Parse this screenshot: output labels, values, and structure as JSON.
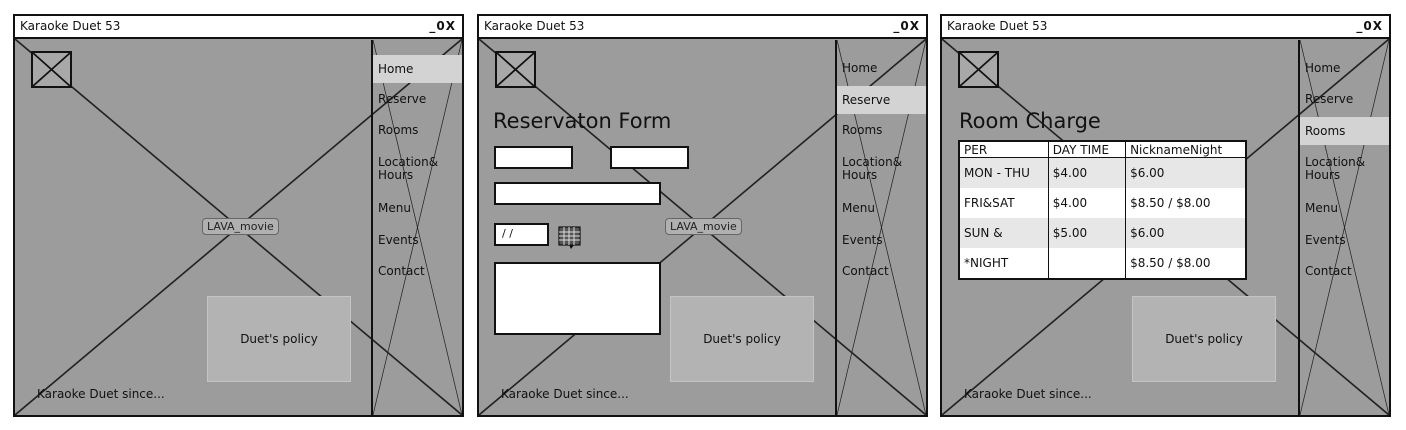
{
  "window": {
    "title": "Karaoke Duet 53",
    "controls": "_0X"
  },
  "nav": [
    "Home",
    "Reserve",
    "Rooms",
    "Location&",
    "Hours",
    "Menu",
    "Events",
    "Contact"
  ],
  "video_label": "LAVA_movie",
  "policy_label": "Duet's policy",
  "footer_text": "Karaoke Duet since...",
  "reservation": {
    "heading": "Reservaton Form",
    "date_value": "/ /"
  },
  "room_charge": {
    "heading": "Room Charge",
    "headers": [
      "PER",
      "DAY TIME",
      "NicknameNight"
    ],
    "rows": [
      [
        "MON - THU",
        "$4.00",
        "$6.00"
      ],
      [
        "FRI&SAT",
        "$4.00",
        "$8.50 / $8.00"
      ],
      [
        "SUN &",
        "$5.00",
        "$6.00"
      ],
      [
        "*NIGHT",
        "",
        "$8.50 / $8.00"
      ]
    ]
  },
  "colors": {
    "background": "#9c9c9c",
    "selected": "#d3d3d3",
    "panel": "#b3b3b3"
  }
}
